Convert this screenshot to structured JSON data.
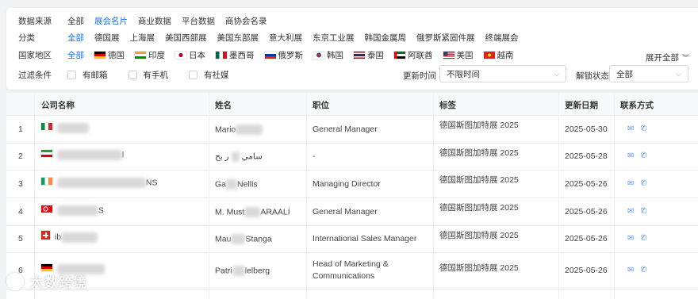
{
  "filters": {
    "source": {
      "label": "数据来源",
      "options": [
        "全部",
        "展会名片",
        "商业数据",
        "平台数据",
        "商协会名录"
      ],
      "active": 1
    },
    "category": {
      "label": "分类",
      "options": [
        "全部",
        "德国展",
        "上海展",
        "美国西部展",
        "美国东部展",
        "意大利展",
        "东京工业展",
        "韩国金属周",
        "俄罗斯紧固件展",
        "终端展会"
      ],
      "active": 0
    },
    "region": {
      "label": "国家地区",
      "all": "全部",
      "countries": [
        "德国",
        "印度",
        "日本",
        "墨西哥",
        "俄罗斯",
        "韩国",
        "泰国",
        "阿联酋",
        "美国",
        "越南"
      ],
      "expand": "展开全部"
    },
    "conditions": {
      "label": "过滤条件",
      "checkboxes": [
        "有邮箱",
        "有手机",
        "有社媒"
      ]
    },
    "update_time": {
      "label": "更新时间",
      "value": "不限时间"
    },
    "unlock_status": {
      "label": "解锁状态",
      "value": "全部"
    }
  },
  "table": {
    "headers": [
      "公司名称",
      "姓名",
      "职位",
      "标签",
      "更新日期",
      "联系方式"
    ],
    "rows": [
      {
        "index": "1",
        "company": "",
        "name_prefix": "Mario",
        "name_suffix": "",
        "position": "General Manager",
        "tag": "德国斯图加特展 2025",
        "date": "2025-05-30"
      },
      {
        "index": "2",
        "company": "l",
        "name_prefix": "سامي",
        "name_suffix": "ر بح",
        "position": "-",
        "tag": "德国斯图加特展 2025",
        "date": "2025-05-28"
      },
      {
        "index": "3",
        "company": "NS",
        "name_prefix": "Ga",
        "name_suffix": "Nellis",
        "position": "Managing Director",
        "tag": "德国斯图加特展 2025",
        "date": "2025-05-26"
      },
      {
        "index": "4",
        "company": "S",
        "name_prefix": "M. Must",
        "name_suffix": "ARAALİ",
        "position": "General Manager",
        "tag": "德国斯图加特展 2025",
        "date": "2025-05-26"
      },
      {
        "index": "5",
        "company": "ib",
        "name_prefix": "Mau",
        "name_suffix": "Stanga",
        "position": "International Sales Manager",
        "tag": "德国斯图加特展 2025",
        "date": "2025-05-26"
      },
      {
        "index": "6",
        "company": "",
        "name_prefix": "Patri",
        "name_suffix": "lelberg",
        "position": "Head of Marketing & Communications",
        "tag": "德国斯图加特展 2025",
        "date": "2025-05-26"
      }
    ]
  },
  "watermark": "大数跨境"
}
